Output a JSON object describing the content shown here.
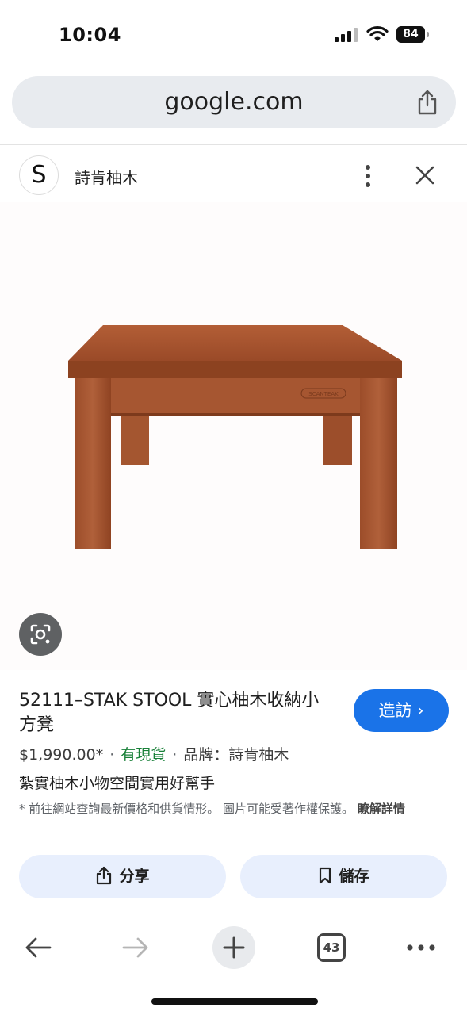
{
  "status_bar": {
    "time": "10:04",
    "battery": "84"
  },
  "browser": {
    "url": "google.com"
  },
  "site": {
    "avatar_letter": "S",
    "name": "詩肯柚木"
  },
  "product": {
    "title": "52111–STAK STOOL 實心柚木收納小方凳",
    "visit_label": "造訪 ›",
    "price": "$1,990.00*",
    "separator": "·",
    "stock": "有現貨",
    "brand": "品牌：詩肯柚木",
    "description": "紮實柚木小物空間實用好幫手",
    "disclaimer": "* 前往網站查詢最新價格和供貨情形。 圖片可能受著作權保護。",
    "learn_more": "瞭解詳情",
    "stamp_text": "SCANTEAK"
  },
  "actions": {
    "share_label": "分享",
    "save_label": "儲存"
  },
  "toolbar": {
    "tab_count": "43"
  },
  "colors": {
    "accent": "#1a73e8",
    "stock_green": "#188038",
    "action_bg": "#e8effd",
    "wood": "#a4532e"
  }
}
